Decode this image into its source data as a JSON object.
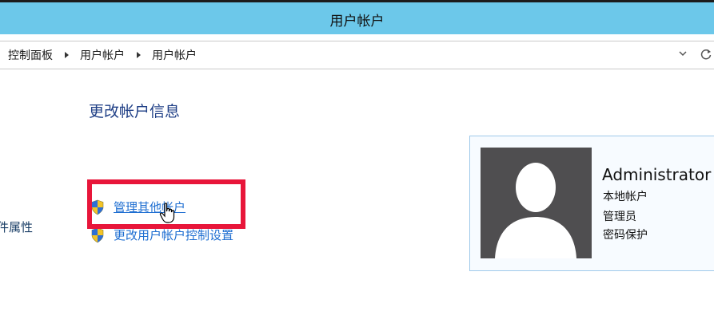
{
  "window": {
    "title": "用户帐户"
  },
  "breadcrumb": {
    "items": [
      "控制面板",
      "用户帐户",
      "用户帐户"
    ]
  },
  "left_panel": {
    "partial_link": "件属性"
  },
  "main": {
    "section_title": "更改帐户信息",
    "tasks": [
      {
        "label": "管理其他帐户",
        "icon": "uac-shield-icon"
      },
      {
        "label": "更改用户帐户控制设置",
        "icon": "uac-shield-icon"
      }
    ]
  },
  "account": {
    "name": "Administrator",
    "type": "本地帐户",
    "role": "管理员",
    "protection": "密码保护"
  },
  "colors": {
    "titlebar": "#6cc8ea",
    "link": "#1e6ed1",
    "section_title": "#1f3f86",
    "highlight": "#e8163a",
    "avatar_bg": "#4f4e50"
  }
}
